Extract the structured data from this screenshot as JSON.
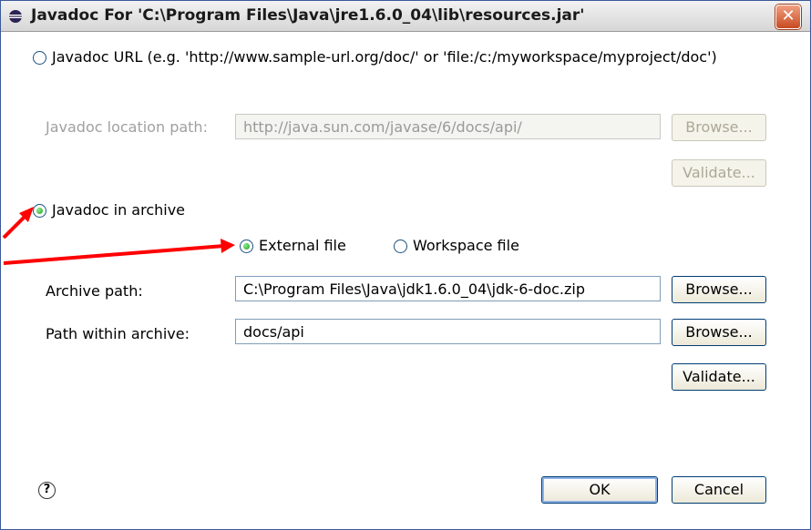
{
  "window": {
    "title": "Javadoc For 'C:\\Program Files\\Java\\jre1.6.0_04\\lib\\resources.jar'",
    "close_glyph": "✕"
  },
  "url_option": {
    "label": "Javadoc URL (e.g. 'http://www.sample-url.org/doc/' or 'file:/c:/myworkspace/myproject/doc')",
    "selected": false,
    "location_label": "Javadoc location path:",
    "location_value": "http://java.sun.com/javase/6/docs/api/",
    "browse_label": "Browse...",
    "validate_label": "Validate..."
  },
  "archive_option": {
    "label": "Javadoc in archive",
    "selected": true,
    "external_label": "External file",
    "external_selected": true,
    "workspace_label": "Workspace file",
    "workspace_selected": false,
    "archive_path_label": "Archive path:",
    "archive_path_value": "C:\\Program Files\\Java\\jdk1.6.0_04\\jdk-6-doc.zip",
    "archive_browse_label": "Browse...",
    "path_within_label": "Path within archive:",
    "path_within_value": "docs/api",
    "path_within_browse_label": "Browse...",
    "validate_label": "Validate..."
  },
  "footer": {
    "help_glyph": "?",
    "ok_label": "OK",
    "cancel_label": "Cancel"
  },
  "colors": {
    "arrow": "#ff0000",
    "close": "#c84a22",
    "accent": "#003c74"
  }
}
